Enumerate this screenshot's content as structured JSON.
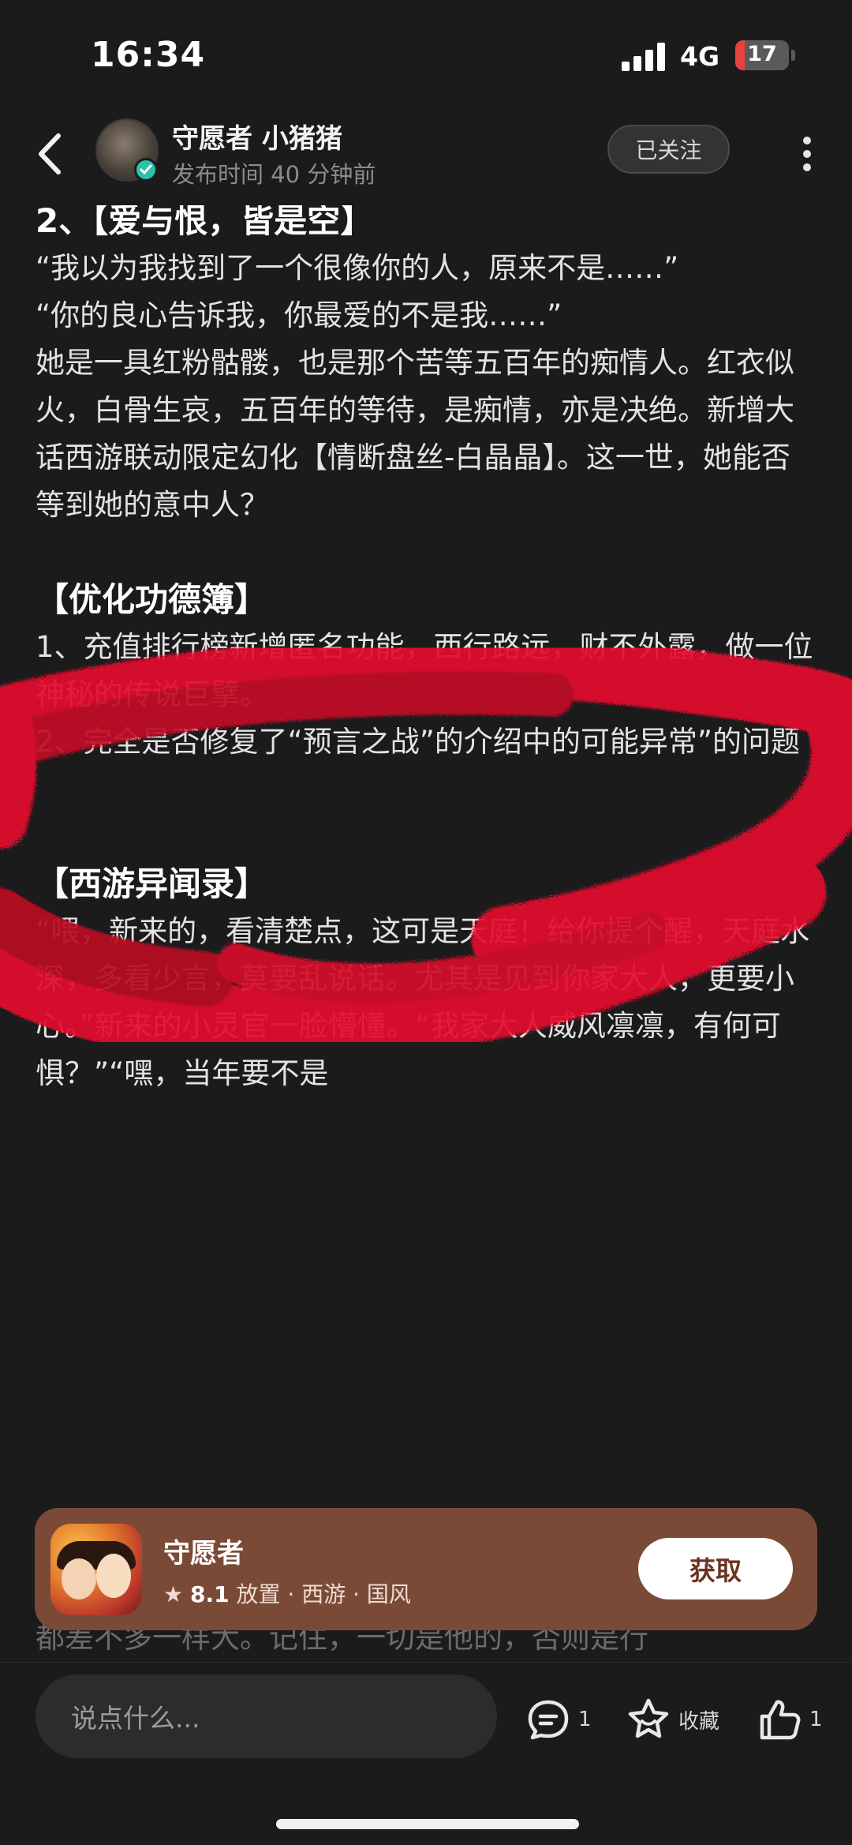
{
  "status_bar": {
    "time": "16:34",
    "network": "4G",
    "battery": "17",
    "battery_level": 0.17
  },
  "header": {
    "author": "守愿者 小猪猪",
    "publish_time": "发布时间 40 分钟前",
    "follow_label": "已关注"
  },
  "article": {
    "paragraphs": [
      {
        "type": "title",
        "text": "2、【爱与恨，皆是空】"
      },
      {
        "type": "text",
        "text": "“我以为我找到了一个很像你的人，原来不是……”"
      },
      {
        "type": "text",
        "text": "“你的良心告诉我，你最爱的不是我……”"
      },
      {
        "type": "text",
        "text": "她是一具红粉骷髅，也是那个苦等五百年的痴情人。红衣似火，白骨生哀，五百年的等待，是痴情，亦是决绝。新增大话西游联动限定幻化【情断盘丝-白晶晶】。这一世，她能否等到她的意中人？"
      },
      {
        "type": "space"
      },
      {
        "type": "title",
        "text": "【优化功德簿】"
      },
      {
        "type": "text",
        "text": "1、充值排行榜新增匿名功能，西行路远，财不外露，做一位神秘的传说巨擘。"
      },
      {
        "type": "text",
        "text": "2、完全是否修复了“预言之战”的介绍中的可能异常”的问题"
      },
      {
        "type": "space"
      },
      {
        "type": "space"
      },
      {
        "type": "title",
        "text": "【西游异闻录】"
      },
      {
        "type": "text",
        "text": "“喂，新来的，看清楚点，这可是天庭！给你提个醒，天庭水深，多看少言，莫要乱说话。尤其是见到你家大人，更要小心。”新来的小灵官一脸懵懂。“我家大人威风凛凛，有何可惧？”“嘿，当年要不是"
      }
    ],
    "faded_line": "都差不多一样大。记住，一切是他的，否则是行"
  },
  "app_card": {
    "name": "守愿者",
    "rating": "8.1",
    "tags": "放置 · 西游 · 国风",
    "get_label": "获取"
  },
  "bottom_bar": {
    "comment_placeholder": "说点什么...",
    "comment_count": "1",
    "favorite_label": "收藏",
    "like_count": "1"
  },
  "colors": {
    "background": "#1b1b1c",
    "card": "#7a4a36",
    "verified": "#2bc0a8",
    "scribble": "#e2102e",
    "battery_low": "#e74242"
  },
  "icons": [
    "back-icon",
    "verified-icon",
    "more-icon",
    "star-icon",
    "comment-icon",
    "favorite-icon",
    "like-icon"
  ]
}
